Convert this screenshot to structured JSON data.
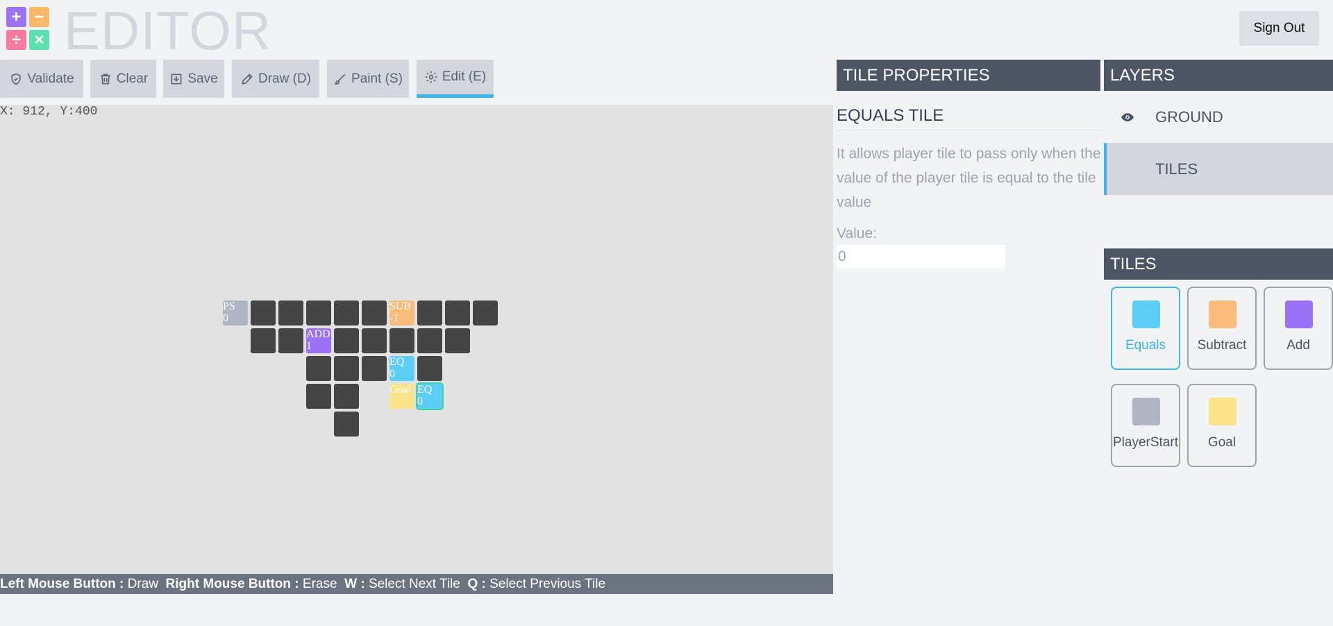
{
  "app": {
    "title": "EDITOR",
    "sign_out": "Sign Out"
  },
  "logo": {
    "tl": "+",
    "tr": "−",
    "bl": "÷",
    "br": "×"
  },
  "toolbar": {
    "validate": "Validate",
    "clear": "Clear",
    "save": "Save",
    "draw": "Draw (D)",
    "paint": "Paint (S)",
    "edit": "Edit (E)",
    "active": "edit"
  },
  "canvas": {
    "coords": "X: 912, Y:400",
    "tiles": [
      {
        "label": "PS\n0",
        "type": "ps"
      },
      {
        "label": "SUB\n-1",
        "type": "sub"
      },
      {
        "label": "ADD\n1",
        "type": "add"
      },
      {
        "label": "EQ\n0",
        "type": "eq"
      },
      {
        "label": "Goal",
        "type": "goal"
      },
      {
        "label": "EQ\n0",
        "type": "eq",
        "selected": true
      }
    ]
  },
  "status": {
    "k1": "Left Mouse Button :",
    "v1": "Draw",
    "k2": "Right Mouse Button :",
    "v2": "Erase",
    "k3": "W :",
    "v3": "Select Next Tile",
    "k4": "Q :",
    "v4": "Select Previous Tile"
  },
  "properties": {
    "header": "TILE PROPERTIES",
    "title": "EQUALS TILE",
    "description": "It allows player tile to pass only when the value of the player tile is equal to the tile value",
    "value_label": "Value:",
    "value": "0"
  },
  "layers": {
    "header": "LAYERS",
    "items": [
      {
        "name": "GROUND",
        "visible": true
      },
      {
        "name": "TILES",
        "selected": true
      }
    ]
  },
  "palette": {
    "header": "TILES",
    "items": [
      {
        "name": "Equals",
        "color": "#5bcdf7",
        "active": true
      },
      {
        "name": "Subtract",
        "color": "#fbbb7a"
      },
      {
        "name": "Add",
        "color": "#9b72f7"
      },
      {
        "name": "PlayerStart",
        "color": "#b0b5c4"
      },
      {
        "name": "Goal",
        "color": "#fce38a"
      }
    ]
  },
  "colors": {
    "accent": "#3ab4e9",
    "panel_header": "#4b5563",
    "tile_dark": "#444444"
  }
}
